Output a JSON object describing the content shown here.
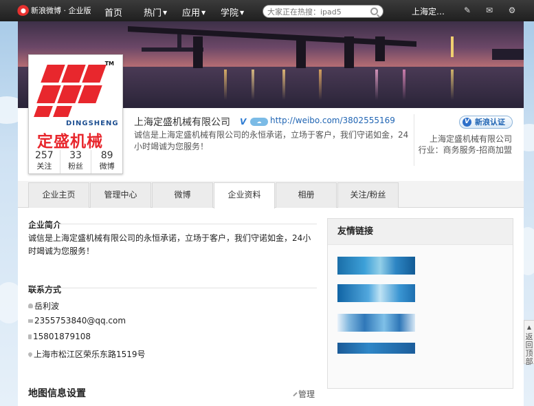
{
  "topbar": {
    "logo_text": "新浪微博 · 企业版",
    "nav": [
      {
        "label": "首页",
        "has_caret": false
      },
      {
        "label": "热门",
        "has_caret": true
      },
      {
        "label": "应用",
        "has_caret": true
      },
      {
        "label": "学院",
        "has_caret": true
      }
    ],
    "search_placeholder": "大家正在热搜：ipad5",
    "user_name": "上海定…",
    "icons": [
      "edit-icon",
      "mail-icon",
      "gear-icon"
    ]
  },
  "profile": {
    "brand_en": "DINGSHENG",
    "brand_cn": "定盛机械",
    "brand_tm": "TM",
    "stats": [
      {
        "num": "257",
        "label": "关注"
      },
      {
        "num": "33",
        "label": "粉丝"
      },
      {
        "num": "89",
        "label": "微博"
      }
    ],
    "company_name": "上海定盛机械有限公司",
    "v_mark": "V",
    "weibo_url": "http://weibo.com/3802555169",
    "slogan": "诚信是上海定盛机械有限公司的永恒承诺，立场于客户，我们守诺如金，24小时竭诚为您服务！",
    "verify_label": "新浪认证",
    "side_company": "上海定盛机械有限公司",
    "side_industry": "行业：商务服务-招商加盟"
  },
  "tabs": [
    {
      "label": "企业主页",
      "active": false
    },
    {
      "label": "管理中心",
      "active": false
    },
    {
      "label": "微博",
      "active": false
    },
    {
      "label": "企业资料",
      "active": true
    },
    {
      "label": "相册",
      "active": false
    },
    {
      "label": "关注/粉丝",
      "active": false
    }
  ],
  "intro": {
    "title": "企业简介",
    "text": "诚信是上海定盛机械有限公司的永恒承诺，立场于客户，我们守诺如金，24小时竭诚为您服务！"
  },
  "contact": {
    "title": "联系方式",
    "person": "岳利波",
    "email": "2355753840@qq.com",
    "phone": "15801879108",
    "address": "上海市松江区荣乐东路1519号"
  },
  "map": {
    "title": "地图信息设置",
    "manage_label": "管理"
  },
  "friend_links": {
    "title": "友情链接"
  },
  "back_to_top": {
    "label": "返回顶部"
  },
  "colors": {
    "brand_red": "#e8272d",
    "link_blue": "#1f64b3",
    "topbar_bg": "#262626"
  }
}
